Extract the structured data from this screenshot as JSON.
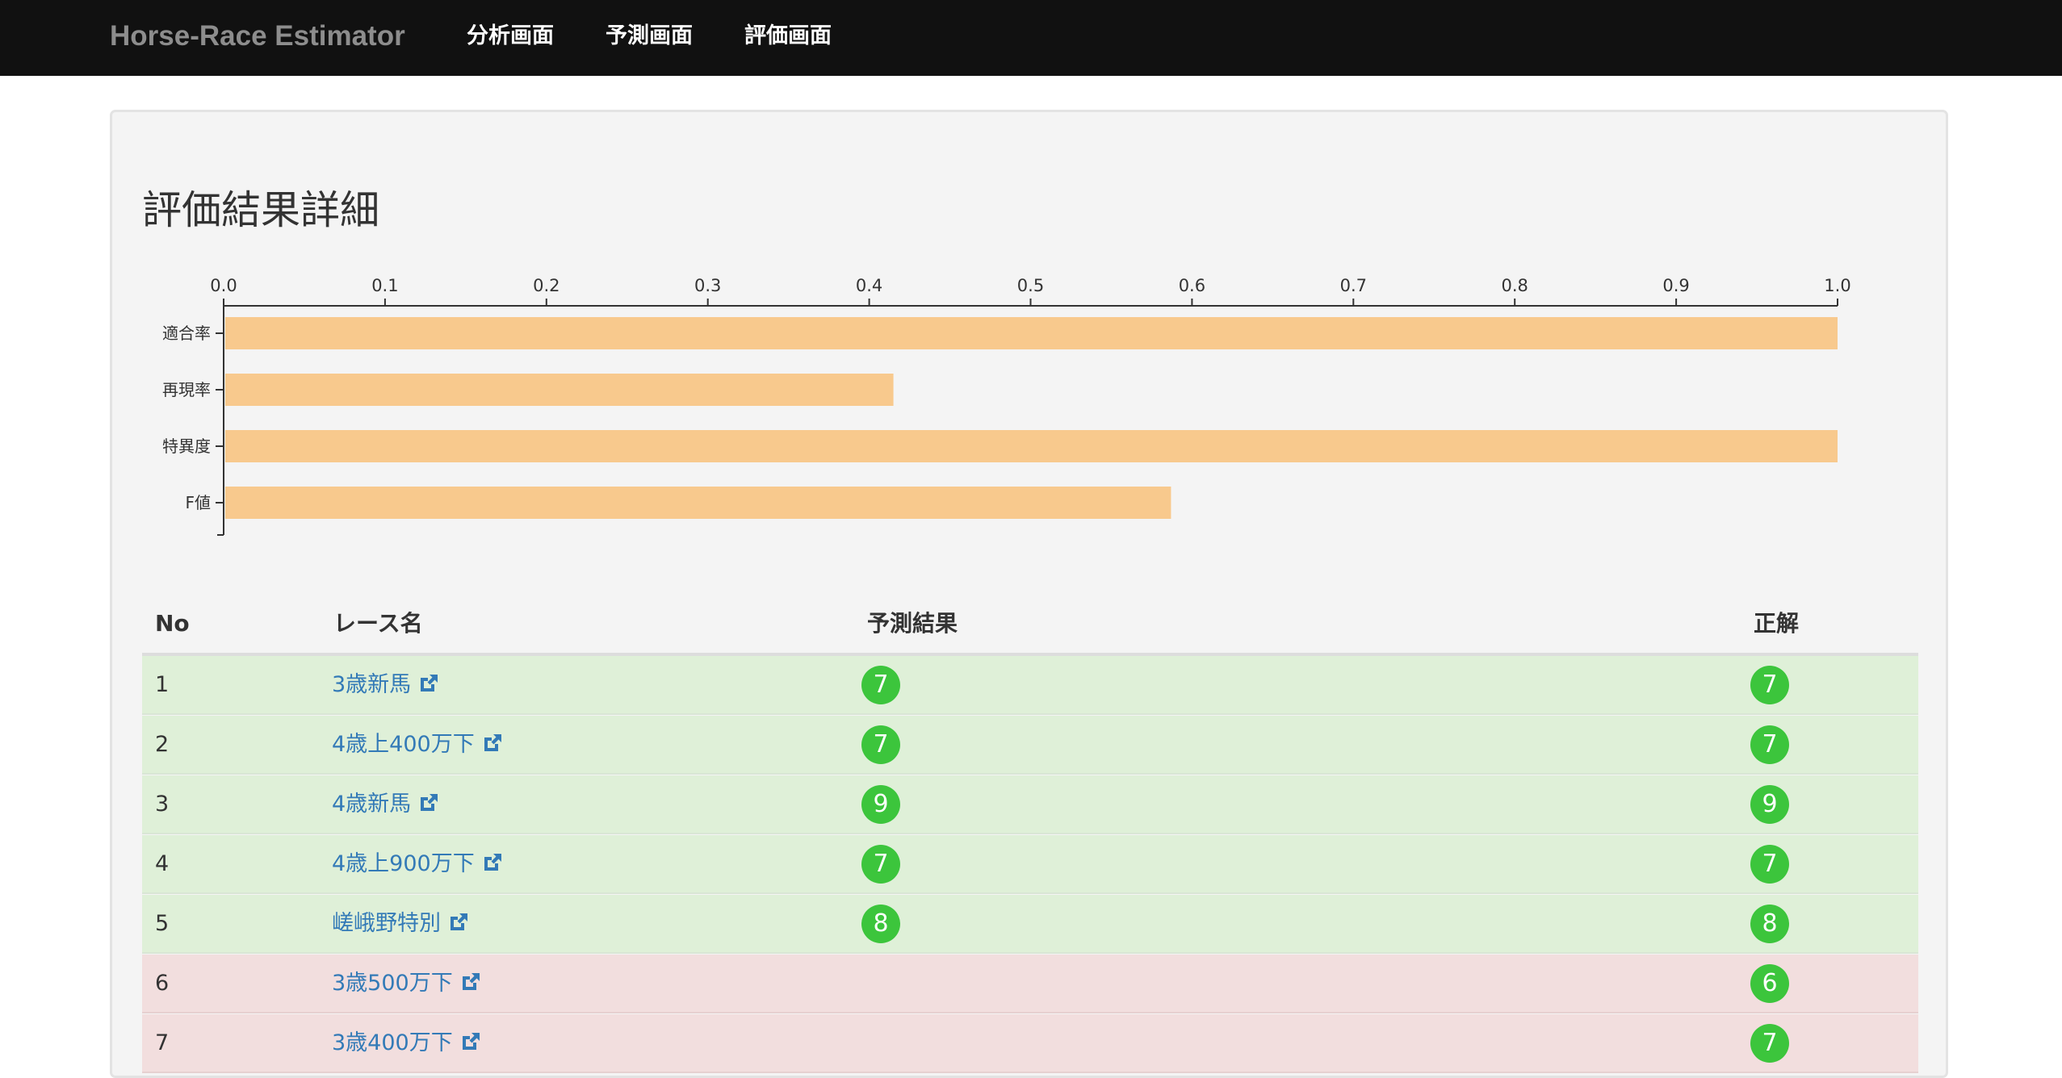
{
  "app": {
    "brand": "Horse-Race Estimator"
  },
  "nav": [
    {
      "label": "分析画面"
    },
    {
      "label": "予測画面"
    },
    {
      "label": "評価画面"
    }
  ],
  "page": {
    "title": "評価結果詳細"
  },
  "chart_data": {
    "type": "bar",
    "orientation": "horizontal",
    "categories": [
      "適合率",
      "再現率",
      "特異度",
      "F値"
    ],
    "values": [
      1.0,
      0.415,
      1.0,
      0.587
    ],
    "xlim": [
      0.0,
      1.0
    ],
    "x_ticks": [
      "0.0",
      "0.1",
      "0.2",
      "0.3",
      "0.4",
      "0.5",
      "0.6",
      "0.7",
      "0.8",
      "0.9",
      "1.0"
    ],
    "x_axis_position": "top",
    "bar_color": "#f8c98d",
    "grid": false
  },
  "table": {
    "headers": {
      "no": "No",
      "race": "レース名",
      "prediction": "予測結果",
      "answer": "正解"
    },
    "rows": [
      {
        "no": "1",
        "race": "3歳新馬",
        "prediction": "7",
        "answer": "7",
        "status": "correct"
      },
      {
        "no": "2",
        "race": "4歳上400万下",
        "prediction": "7",
        "answer": "7",
        "status": "correct"
      },
      {
        "no": "3",
        "race": "4歳新馬",
        "prediction": "9",
        "answer": "9",
        "status": "correct"
      },
      {
        "no": "4",
        "race": "4歳上900万下",
        "prediction": "7",
        "answer": "7",
        "status": "correct"
      },
      {
        "no": "5",
        "race": "嵯峨野特別",
        "prediction": "8",
        "answer": "8",
        "status": "correct"
      },
      {
        "no": "6",
        "race": "3歳500万下",
        "prediction": "",
        "answer": "6",
        "status": "incorrect"
      },
      {
        "no": "7",
        "race": "3歳400万下",
        "prediction": "",
        "answer": "7",
        "status": "incorrect"
      }
    ]
  },
  "colors": {
    "navbar": "#111111",
    "link": "#337ab7",
    "badge": "#3cc53c",
    "row_correct": "#dff0d8",
    "row_incorrect": "#f2dede"
  },
  "icons": {
    "external_link": "external-link-icon"
  }
}
